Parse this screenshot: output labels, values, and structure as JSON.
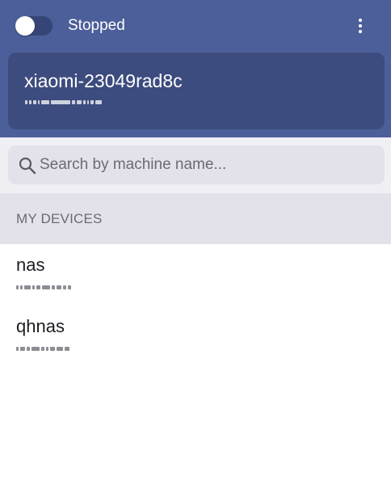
{
  "header": {
    "status_label": "Stopped",
    "toggle_state": "off",
    "current_device": {
      "name": "xiaomi-23049rad8c"
    }
  },
  "search": {
    "placeholder": "Search by machine name..."
  },
  "sections": [
    {
      "title": "MY DEVICES",
      "devices": [
        {
          "name": "nas"
        },
        {
          "name": "qhnas"
        }
      ]
    }
  ],
  "colors": {
    "header_bg": "#4c5f9a",
    "card_bg": "#3d4c7e",
    "toggle_track": "#354577",
    "search_area_bg": "#f0eff4",
    "search_box_bg": "#e3e2ea",
    "section_header_bg": "#e3e2ea"
  },
  "icons": {
    "menu": "more-vert-icon",
    "search": "search-icon"
  }
}
